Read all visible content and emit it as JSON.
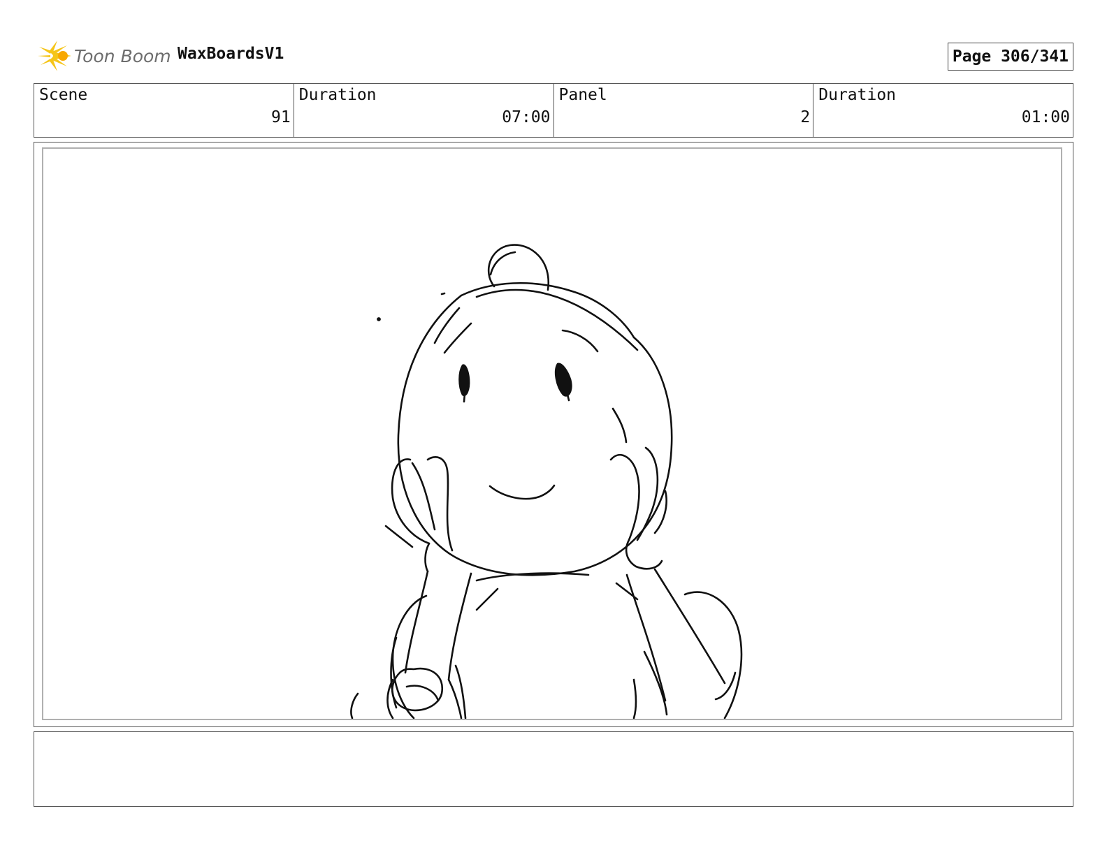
{
  "header": {
    "logo_text": "Toon Boom",
    "logo_icon": "toon-boom-burst-icon",
    "project_name": "WaxBoardsV1",
    "page_label": "Page 306/341"
  },
  "info": {
    "scene_label": "Scene",
    "scene_value": "91",
    "scene_duration_label": "Duration",
    "scene_duration_value": "07:00",
    "panel_label": "Panel",
    "panel_value": "2",
    "panel_duration_label": "Duration",
    "panel_duration_value": "01:00"
  },
  "panel": {
    "drawing": "sketch-character-icon"
  },
  "notes": {
    "text": ""
  },
  "colors": {
    "logo_burst": "#f5c518",
    "logo_text": "#6d6d6d",
    "ink": "#111111",
    "frame_border": "#555555",
    "inner_border": "#b0b0b0"
  }
}
